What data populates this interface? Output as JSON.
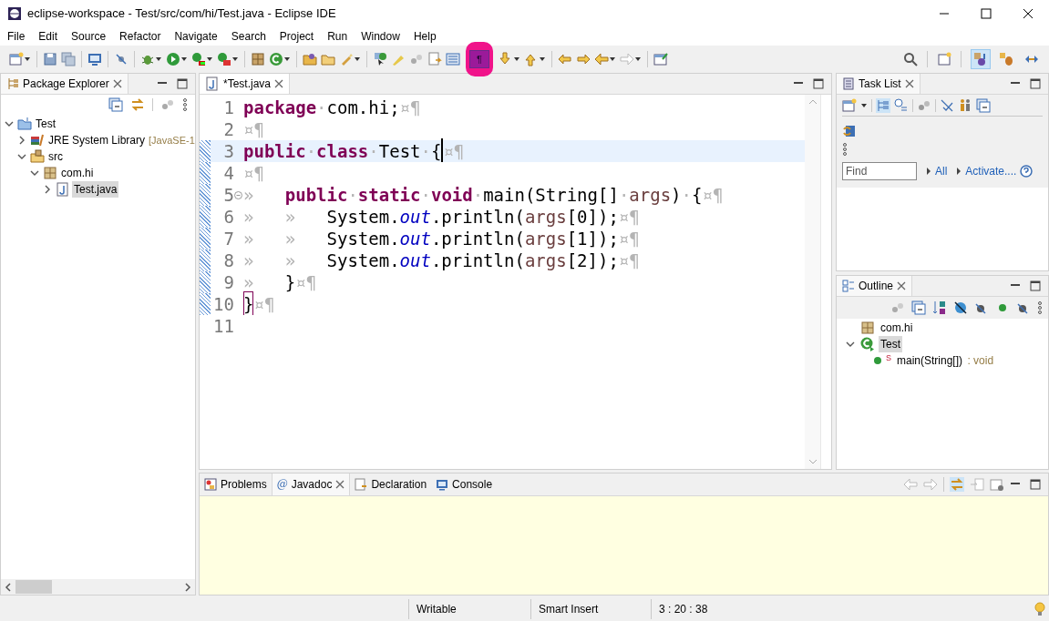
{
  "window": {
    "title": "eclipse-workspace - Test/src/com/hi/Test.java - Eclipse IDE"
  },
  "menu": [
    "File",
    "Edit",
    "Source",
    "Refactor",
    "Navigate",
    "Search",
    "Project",
    "Run",
    "Window",
    "Help"
  ],
  "toolbar": {
    "pilcrow": "¶",
    "whitespace_on": true,
    "perspectives": [
      {
        "selected": true
      },
      {
        "selected": false
      },
      {
        "selected": false
      }
    ]
  },
  "package_explorer": {
    "title": "Package Explorer",
    "tree": [
      {
        "label": "Test",
        "kind": "project",
        "expanded": true,
        "selected": false,
        "children": [
          {
            "label": "JRE System Library",
            "suffix": "[JavaSE-1",
            "kind": "library",
            "expanded": false,
            "selected": false
          },
          {
            "label": "src",
            "kind": "folder",
            "expanded": true,
            "selected": false,
            "children": [
              {
                "label": "com.hi",
                "kind": "package",
                "expanded": true,
                "selected": false,
                "children": [
                  {
                    "label": "Test.java",
                    "kind": "file",
                    "expanded": false,
                    "selected": true
                  }
                ]
              }
            ]
          }
        ]
      }
    ]
  },
  "editor": {
    "tab": {
      "label": "*Test.java",
      "selected": true
    },
    "lines": [
      {
        "number": "1",
        "current": false,
        "changed": false,
        "foldable": false,
        "tokens": [
          {
            "t": "package",
            "kind": "kw"
          },
          {
            "t": "·",
            "kind": "ws"
          },
          {
            "t": "com.hi;",
            "kind": "id"
          },
          {
            "t": "¤¶",
            "kind": "ws"
          }
        ]
      },
      {
        "number": "2",
        "current": false,
        "changed": false,
        "foldable": false,
        "tokens": [
          {
            "t": "¤¶",
            "kind": "ws"
          }
        ]
      },
      {
        "number": "3",
        "current": true,
        "changed": true,
        "foldable": false,
        "tokens": [
          {
            "t": "public",
            "kind": "kw"
          },
          {
            "t": "·",
            "kind": "ws"
          },
          {
            "t": "class",
            "kind": "kw"
          },
          {
            "t": "·",
            "kind": "ws"
          },
          {
            "t": "Test",
            "kind": "id"
          },
          {
            "t": "·",
            "kind": "ws"
          },
          {
            "t": "{",
            "kind": "id",
            "caret": true
          },
          {
            "t": "¤¶",
            "kind": "ws"
          }
        ]
      },
      {
        "number": "4",
        "current": false,
        "changed": true,
        "foldable": false,
        "tokens": [
          {
            "t": "¤¶",
            "kind": "ws"
          }
        ]
      },
      {
        "number": "5",
        "current": false,
        "changed": true,
        "foldable": true,
        "tokens": [
          {
            "t": "»   ",
            "kind": "ws"
          },
          {
            "t": "public",
            "kind": "kw"
          },
          {
            "t": "·",
            "kind": "ws"
          },
          {
            "t": "static",
            "kind": "kw"
          },
          {
            "t": "·",
            "kind": "ws"
          },
          {
            "t": "void",
            "kind": "kw"
          },
          {
            "t": "·",
            "kind": "ws"
          },
          {
            "t": "main(String[]",
            "kind": "id"
          },
          {
            "t": "·",
            "kind": "ws"
          },
          {
            "t": "args",
            "kind": "var"
          },
          {
            "t": ")",
            "kind": "id"
          },
          {
            "t": "·",
            "kind": "ws"
          },
          {
            "t": "{",
            "kind": "id"
          },
          {
            "t": "¤¶",
            "kind": "ws"
          }
        ]
      },
      {
        "number": "6",
        "current": false,
        "changed": true,
        "foldable": false,
        "tokens": [
          {
            "t": "»   »   ",
            "kind": "ws"
          },
          {
            "t": "System.",
            "kind": "id"
          },
          {
            "t": "out",
            "kind": "fld"
          },
          {
            "t": ".println(",
            "kind": "id"
          },
          {
            "t": "args",
            "kind": "var"
          },
          {
            "t": "[0]);",
            "kind": "id"
          },
          {
            "t": "¤¶",
            "kind": "ws"
          }
        ]
      },
      {
        "number": "7",
        "current": false,
        "changed": true,
        "foldable": false,
        "tokens": [
          {
            "t": "»   »   ",
            "kind": "ws"
          },
          {
            "t": "System.",
            "kind": "id"
          },
          {
            "t": "out",
            "kind": "fld"
          },
          {
            "t": ".println(",
            "kind": "id"
          },
          {
            "t": "args",
            "kind": "var"
          },
          {
            "t": "[1]);",
            "kind": "id"
          },
          {
            "t": "¤¶",
            "kind": "ws"
          }
        ]
      },
      {
        "number": "8",
        "current": false,
        "changed": true,
        "foldable": false,
        "tokens": [
          {
            "t": "»   »   ",
            "kind": "ws"
          },
          {
            "t": "System.",
            "kind": "id"
          },
          {
            "t": "out",
            "kind": "fld"
          },
          {
            "t": ".println(",
            "kind": "id"
          },
          {
            "t": "args",
            "kind": "var"
          },
          {
            "t": "[2]);",
            "kind": "id"
          },
          {
            "t": "¤¶",
            "kind": "ws"
          }
        ]
      },
      {
        "number": "9",
        "current": false,
        "changed": true,
        "foldable": false,
        "tokens": [
          {
            "t": "»   ",
            "kind": "ws"
          },
          {
            "t": "}",
            "kind": "id"
          },
          {
            "t": "¤¶",
            "kind": "ws"
          }
        ]
      },
      {
        "number": "10",
        "current": false,
        "changed": true,
        "foldable": false,
        "tokens": [
          {
            "t": "}",
            "kind": "id",
            "matched": true
          },
          {
            "t": "¤¶",
            "kind": "ws"
          }
        ]
      },
      {
        "number": "11",
        "current": false,
        "changed": false,
        "foldable": false
      }
    ]
  },
  "task_list": {
    "title": "Task List",
    "find_placeholder": "Find",
    "links": [
      "All",
      "Activate...."
    ]
  },
  "outline": {
    "title": "Outline",
    "tree": [
      {
        "label": "com.hi",
        "kind": "package",
        "selected": false
      },
      {
        "label": "Test",
        "kind": "class",
        "expanded": true,
        "selected": true,
        "children": [
          {
            "label": "main(String[])",
            "type": " : void",
            "modifier": "S",
            "kind": "method",
            "selected": false
          }
        ]
      }
    ]
  },
  "bottom_panel": {
    "tabs": [
      {
        "label": "Problems",
        "kind": "problems",
        "selected": false
      },
      {
        "label": "Javadoc",
        "kind": "javadoc",
        "glyph": "@",
        "selected": true
      },
      {
        "label": "Declaration",
        "kind": "declaration",
        "selected": false
      },
      {
        "label": "Console",
        "kind": "console",
        "selected": false
      }
    ]
  },
  "status_bar": [
    "Writable",
    "Smart Insert",
    "3 : 20 : 38"
  ]
}
